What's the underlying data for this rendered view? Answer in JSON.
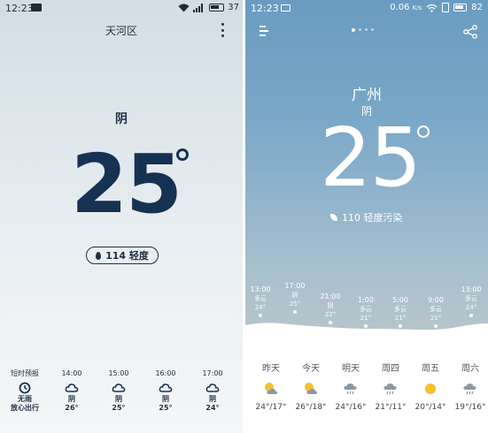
{
  "left_screen": {
    "status": {
      "time": "12:23",
      "battery": "37",
      "icons": [
        "message-icon",
        "wifi-icon",
        "signal-icon",
        "battery-icon"
      ]
    },
    "location": "天河区",
    "condition": "阴",
    "temperature": "25",
    "aqi": "114 轻度",
    "forecast": [
      {
        "time": "短时预报",
        "icon": "clock-icon",
        "cond": "无雨",
        "value": "放心出行"
      },
      {
        "time": "14:00",
        "icon": "cloud-icon",
        "cond": "阴",
        "value": "26°"
      },
      {
        "time": "15:00",
        "icon": "cloud-icon",
        "cond": "阴",
        "value": "25°"
      },
      {
        "time": "16:00",
        "icon": "cloud-icon",
        "cond": "阴",
        "value": "25°"
      },
      {
        "time": "17:00",
        "icon": "cloud-icon",
        "cond": "阴",
        "value": "24°"
      }
    ]
  },
  "right_screen": {
    "status": {
      "time": "12:23",
      "speed": "0.06",
      "speed_unit": "K/s",
      "battery": "82",
      "icons": [
        "image-icon",
        "wifi-icon",
        "vibrate-icon",
        "battery-icon"
      ]
    },
    "city": "广州",
    "condition": "阴",
    "temperature": "25",
    "aqi": "110 轻度污染",
    "hourly": [
      {
        "time": "13:00",
        "cond": "多云",
        "temp": "24°"
      },
      {
        "time": "17:00",
        "cond": "阴",
        "temp": "25°"
      },
      {
        "time": "21:00",
        "cond": "阴",
        "temp": "22°"
      },
      {
        "time": "1:00",
        "cond": "多云",
        "temp": "21°"
      },
      {
        "time": "5:00",
        "cond": "多云",
        "temp": "21°"
      },
      {
        "time": "9:00",
        "cond": "多云",
        "temp": "21°"
      },
      {
        "time": "13:00",
        "cond": "多云",
        "temp": "24°"
      }
    ],
    "daily": [
      {
        "name": "昨天",
        "icon": "partly-cloudy-icon",
        "range": "24°/17°"
      },
      {
        "name": "今天",
        "icon": "partly-cloudy-icon",
        "range": "26°/18°"
      },
      {
        "name": "明天",
        "icon": "rain-cloud-icon",
        "range": "24°/16°"
      },
      {
        "name": "周四",
        "icon": "rain-cloud-icon",
        "range": "21°/11°"
      },
      {
        "name": "周五",
        "icon": "sun-icon",
        "range": "20°/14°"
      },
      {
        "name": "周六",
        "icon": "rain-cloud-icon",
        "range": "19°/16°"
      }
    ]
  },
  "colors": {
    "left_text": "#163252",
    "right_sky": "#78a6c7",
    "sun": "#f5c12e",
    "cloud_grey": "#8c98a3"
  }
}
